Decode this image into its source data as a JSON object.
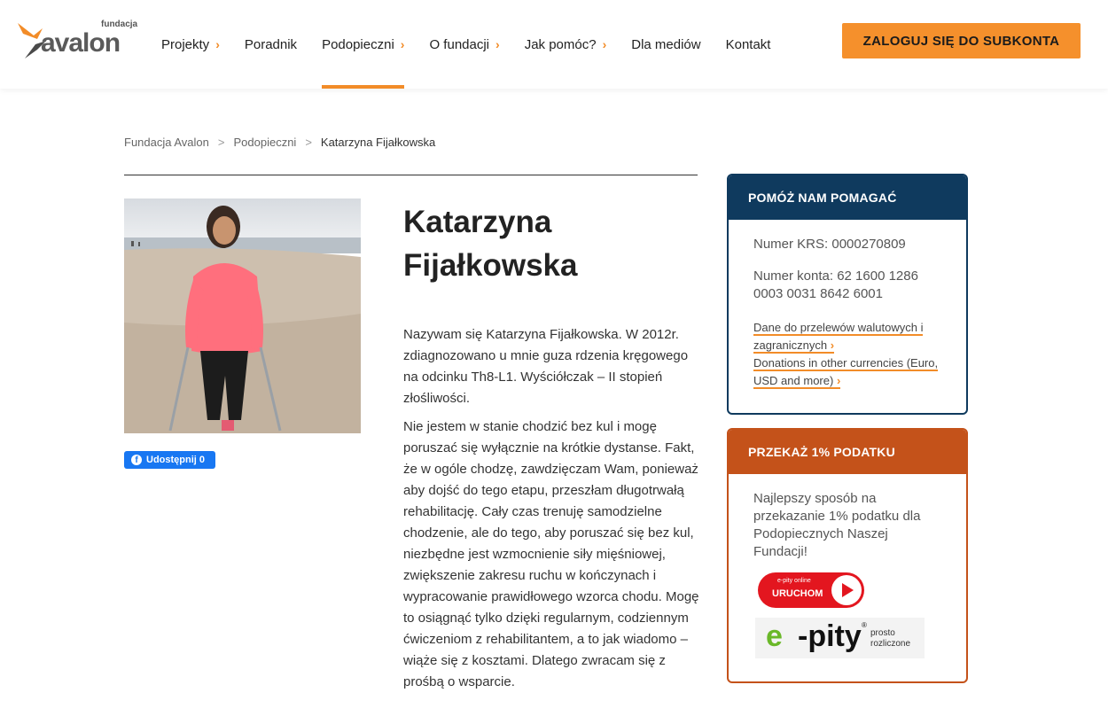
{
  "logo": {
    "small": "fundacja",
    "big": "avalon"
  },
  "nav": [
    {
      "label": "Projekty",
      "chev": "›"
    },
    {
      "label": "Poradnik"
    },
    {
      "label": "Podopieczni",
      "chev": "›"
    },
    {
      "label": "O fundacji",
      "chev": "›"
    },
    {
      "label": "Jak pomóc?",
      "chev": "›"
    },
    {
      "label": "Dla mediów"
    },
    {
      "label": "Kontakt"
    }
  ],
  "login_label": "ZALOGUJ SIĘ DO SUBKONTA",
  "breadcrumb": {
    "home": "Fundacja Avalon",
    "section": "Podopieczni",
    "current": "Katarzyna Fijałkowska",
    "sep": ">"
  },
  "share": {
    "label": "Udostępnij 0",
    "fb": "f"
  },
  "title": "Katarzyna Fijałkowska",
  "article": {
    "p1": "Nazywam się Katarzyna Fijałkowska. W 2012r. zdiagnozowano u mnie guza rdzenia kręgowego na odcinku Th8-L1. Wyściółczak – II stopień złośliwości.",
    "p2": "Nie jestem w stanie chodzić bez kul i mogę poruszać się wyłącznie na krótkie dystanse. Fakt, że w ogóle chodzę, zawdzięczam Wam, ponieważ aby dojść do tego etapu, przeszłam długotrwałą rehabilitację. Cały czas trenuję samodzielne chodzenie, ale do tego, aby poruszać się bez kul, niezbędne jest wzmocnienie siły mięśniowej, zwiększenie zakresu ruchu w kończynach i wypracowanie prawidłowego wzorca chodu. Mogę to osiągnąć tylko dzięki regularnym, codziennym ćwiczeniom z rehabilitantem, a to jak wiadomo – wiąże się z kosztami. Dlatego zwracam się z prośbą o wsparcie."
  },
  "help_box": {
    "title": "POMÓŻ NAM POMAGAĆ",
    "krs": "Numer KRS: 0000270809",
    "account": "Numer konta: 62 1600 1286 0003 0031 8642 6001",
    "link1": "Dane do przelewów walutowych i zagranicznych",
    "link2": "Donations in other currencies (Euro, USD and more)",
    "chev": "›"
  },
  "tax_box": {
    "title": "PRZEKAŻ 1% PODATKU",
    "text": "Najlepszy sposób na przekazanie 1% podatku dla Podopiecznych Naszej Fundacji!",
    "epity_small": "e-pity online",
    "epity_big": "URUCHOM",
    "logo_e": "e",
    "logo_pity": "-pity",
    "logo_reg": "®",
    "logo_tag1": "prosto",
    "logo_tag2": "rozliczone"
  },
  "colors": {
    "accent": "#f28c28",
    "navy": "#0f3a5e",
    "rust": "#c4521a",
    "fb": "#1877f2"
  }
}
